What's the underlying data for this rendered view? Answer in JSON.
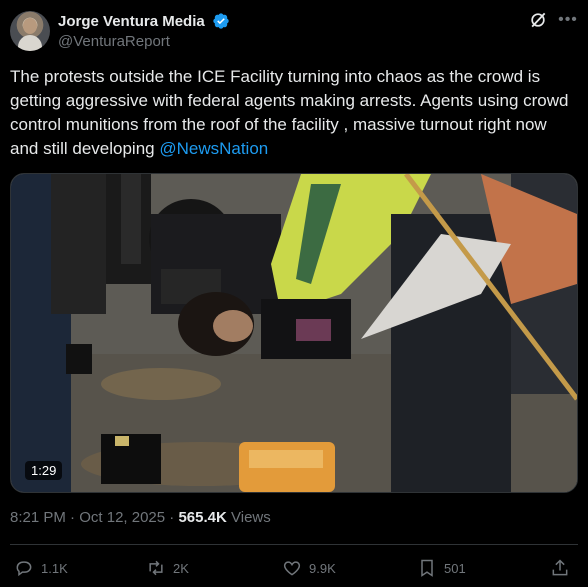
{
  "author": {
    "display_name": "Jorge Ventura Media",
    "handle": "@VenturaReport",
    "verified": true
  },
  "tweet": {
    "text": "The protests outside the ICE Facility turning into chaos as the crowd is getting aggressive with federal agents making arrests. Agents using crowd control munitions from the roof of the facility , massive turnout right now and still developing ",
    "mention": "@NewsNation"
  },
  "media": {
    "duration": "1:29"
  },
  "meta": {
    "time": "8:21 PM",
    "separator": "·",
    "date": "Oct 12, 2025",
    "views_count": "565.4K",
    "views_label": "Views"
  },
  "actions": {
    "replies": "1.1K",
    "reposts": "2K",
    "likes": "9.9K",
    "bookmarks": "501"
  },
  "colors": {
    "background": "#000000",
    "text": "#e7e9ea",
    "secondary": "#71767b",
    "accent": "#1d9bf0",
    "divider": "#2f3336"
  },
  "icons": [
    "verified-badge-icon",
    "grok-icon",
    "more-icon",
    "reply-icon",
    "repost-icon",
    "like-icon",
    "bookmark-icon",
    "share-icon"
  ]
}
